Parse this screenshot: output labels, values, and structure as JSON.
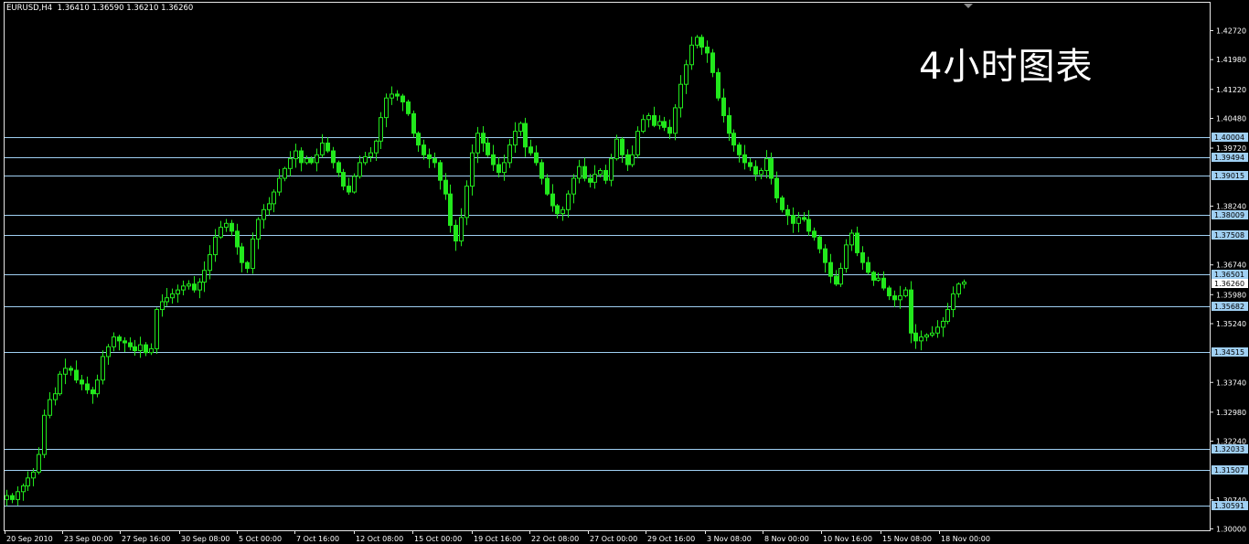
{
  "header": {
    "symbol": "EURUSD,H4",
    "ohlc": [
      "1.36410",
      "1.36590",
      "1.36210",
      "1.36260"
    ]
  },
  "overlay_title": "4小时图表",
  "colors": {
    "background": "#000000",
    "candle": "#22e81c",
    "frame": "#e6e6e6",
    "level_line": "#9fcff2",
    "level_badge": "#9fcff2",
    "current_badge": "#ffffff"
  },
  "chart_data": {
    "type": "candlestick",
    "title": "",
    "ylim": [
      1.3,
      1.431
    ],
    "y_ticks": [
      "1.42720",
      "1.41980",
      "1.41220",
      "1.40480",
      "1.39720",
      "1.38240",
      "1.36740",
      "1.35980",
      "1.35240",
      "1.33740",
      "1.32980",
      "1.32240",
      "1.30740",
      "1.30000"
    ],
    "x_ticks": [
      "20 Sep 2010",
      "23 Sep 00:00",
      "27 Sep 16:00",
      "30 Sep 08:00",
      "5 Oct 00:00",
      "7 Oct 16:00",
      "12 Oct 08:00",
      "15 Oct 00:00",
      "19 Oct 16:00",
      "22 Oct 08:00",
      "27 Oct 00:00",
      "29 Oct 16:00",
      "3 Nov 08:00",
      "8 Nov 00:00",
      "10 Nov 16:00",
      "15 Nov 08:00",
      "18 Nov 00:00"
    ],
    "horizontal_levels": [
      "1.40004",
      "1.39494",
      "1.39015",
      "1.38009",
      "1.37508",
      "1.36501",
      "1.35682",
      "1.34515",
      "1.32033",
      "1.31507",
      "1.30591"
    ],
    "current_price": "1.36260",
    "close_path": [
      1.3085,
      1.3075,
      1.3095,
      1.311,
      1.313,
      1.3145,
      1.319,
      1.329,
      1.333,
      1.3345,
      1.3395,
      1.341,
      1.3405,
      1.338,
      1.337,
      1.3355,
      1.3345,
      1.338,
      1.344,
      1.3465,
      1.349,
      1.348,
      1.3475,
      1.3465,
      1.3455,
      1.347,
      1.345,
      1.346,
      1.356,
      1.358,
      1.359,
      1.36,
      1.361,
      1.362,
      1.3625,
      1.361,
      1.363,
      1.366,
      1.37,
      1.3745,
      1.377,
      1.378,
      1.376,
      1.372,
      1.368,
      1.3665,
      1.374,
      1.379,
      1.3815,
      1.383,
      1.386,
      1.3895,
      1.392,
      1.3945,
      1.3965,
      1.3935,
      1.3945,
      1.3935,
      1.3955,
      1.3985,
      1.3965,
      1.3935,
      1.391,
      1.3875,
      1.386,
      1.39,
      1.3935,
      1.395,
      1.396,
      1.399,
      1.405,
      1.41,
      1.411,
      1.4105,
      1.409,
      1.406,
      1.401,
      1.398,
      1.3955,
      1.3945,
      1.3935,
      1.389,
      1.3855,
      1.3775,
      1.3735,
      1.3795,
      1.3875,
      1.396,
      1.401,
      1.3985,
      1.3955,
      1.393,
      1.391,
      1.3935,
      1.398,
      1.4015,
      1.4035,
      1.3975,
      1.396,
      1.3935,
      1.3895,
      1.3855,
      1.3825,
      1.3805,
      1.3815,
      1.3855,
      1.3895,
      1.3925,
      1.3895,
      1.3885,
      1.3905,
      1.3915,
      1.389,
      1.3945,
      1.3995,
      1.3955,
      1.393,
      1.3955,
      1.4015,
      1.4045,
      1.4055,
      1.403,
      1.404,
      1.4025,
      1.401,
      1.4075,
      1.4135,
      1.4185,
      1.4235,
      1.4255,
      1.423,
      1.4215,
      1.4165,
      1.41,
      1.4055,
      1.401,
      1.398,
      1.3955,
      1.3935,
      1.3925,
      1.3905,
      1.3915,
      1.3945,
      1.3895,
      1.3845,
      1.3815,
      1.38,
      1.378,
      1.3795,
      1.379,
      1.376,
      1.3745,
      1.3715,
      1.368,
      1.3645,
      1.3625,
      1.3665,
      1.3725,
      1.3755,
      1.3705,
      1.368,
      1.3655,
      1.3635,
      1.364,
      1.3615,
      1.3595,
      1.3585,
      1.3595,
      1.361,
      1.35,
      1.348,
      1.349,
      1.3495,
      1.35,
      1.3515,
      1.353,
      1.356,
      1.36,
      1.3625,
      1.363
    ]
  }
}
